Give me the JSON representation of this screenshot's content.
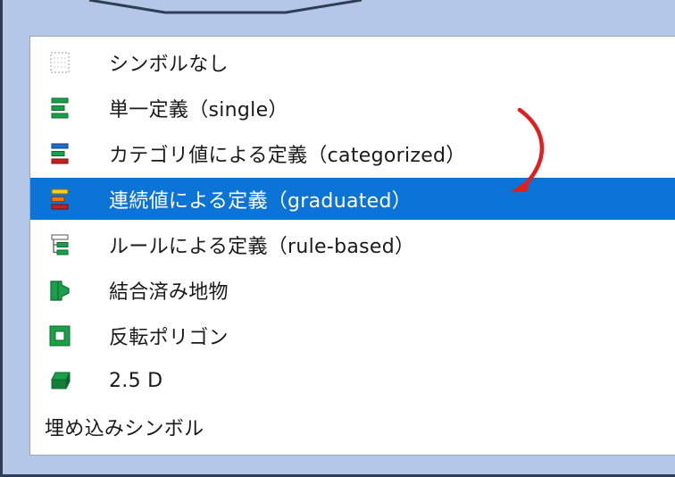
{
  "menu": {
    "items": [
      {
        "label": "シンボルなし",
        "icon": "no-symbol-icon"
      },
      {
        "label": "単一定義（single）",
        "icon": "single-symbol-icon"
      },
      {
        "label": "カテゴリ値による定義（categorized）",
        "icon": "categorized-icon"
      },
      {
        "label": "連続値による定義（graduated）",
        "icon": "graduated-icon",
        "selected": true
      },
      {
        "label": "ルールによる定義（rule-based）",
        "icon": "rule-based-icon"
      },
      {
        "label": "結合済み地物",
        "icon": "merged-features-icon"
      },
      {
        "label": "反転ポリゴン",
        "icon": "inverted-polygon-icon"
      },
      {
        "label": "2.5 D",
        "icon": "2-5d-icon"
      },
      {
        "label": "埋め込みシンボル",
        "icon": null
      }
    ]
  },
  "colors": {
    "selection": "#0b74d6",
    "annotation_arrow": "#e02020",
    "background": "#b5c7e6"
  }
}
